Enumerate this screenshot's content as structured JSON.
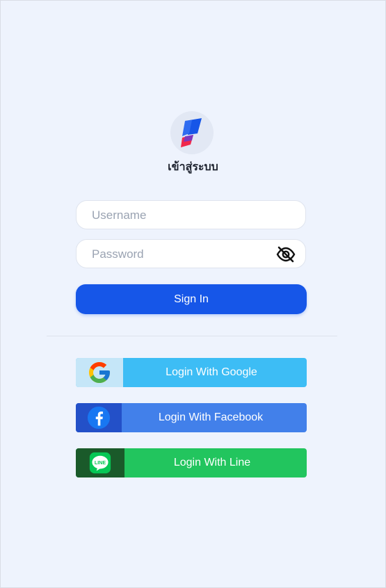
{
  "title": "เข้าสู่ระบบ",
  "username": {
    "placeholder": "Username",
    "value": ""
  },
  "password": {
    "placeholder": "Password",
    "value": ""
  },
  "sign_in_label": "Sign In",
  "social": [
    {
      "label": "Login With Google",
      "icon": "google-icon",
      "color": "#3dbdf5",
      "icon_bg": "#c5e6f8"
    },
    {
      "label": "Login With Facebook",
      "icon": "facebook-icon",
      "color": "#4280ea",
      "icon_bg": "#2350c8"
    },
    {
      "label": "Login With Line",
      "icon": "line-icon",
      "color": "#22c55e",
      "icon_bg": "#1a5a2a"
    }
  ],
  "colors": {
    "background": "#eef3fd",
    "primary": "#1656e8"
  }
}
